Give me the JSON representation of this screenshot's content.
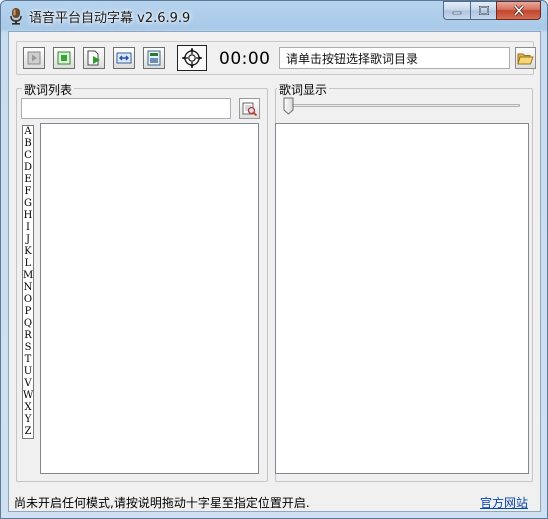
{
  "window": {
    "title": "语音平台自动字幕 v2.6.9.9"
  },
  "toolbar": {
    "timer": "00:00",
    "directory_value": "请单击按钮选择歌词目录"
  },
  "lyrics_list": {
    "legend": "歌词列表",
    "search_value": "",
    "alphabet": [
      "A",
      "B",
      "C",
      "D",
      "E",
      "F",
      "G",
      "H",
      "I",
      "J",
      "K",
      "L",
      "M",
      "N",
      "O",
      "P",
      "Q",
      "R",
      "S",
      "T",
      "U",
      "V",
      "W",
      "X",
      "Y",
      "Z"
    ]
  },
  "lyrics_display": {
    "legend": "歌词显示",
    "slider_value": 0
  },
  "status": {
    "message": "尚未开启任何模式,请按说明拖动十字星至指定位置开启.",
    "link": "官方网站"
  },
  "colors": {
    "link": "#0645ad",
    "close_button": "#c1442c"
  }
}
